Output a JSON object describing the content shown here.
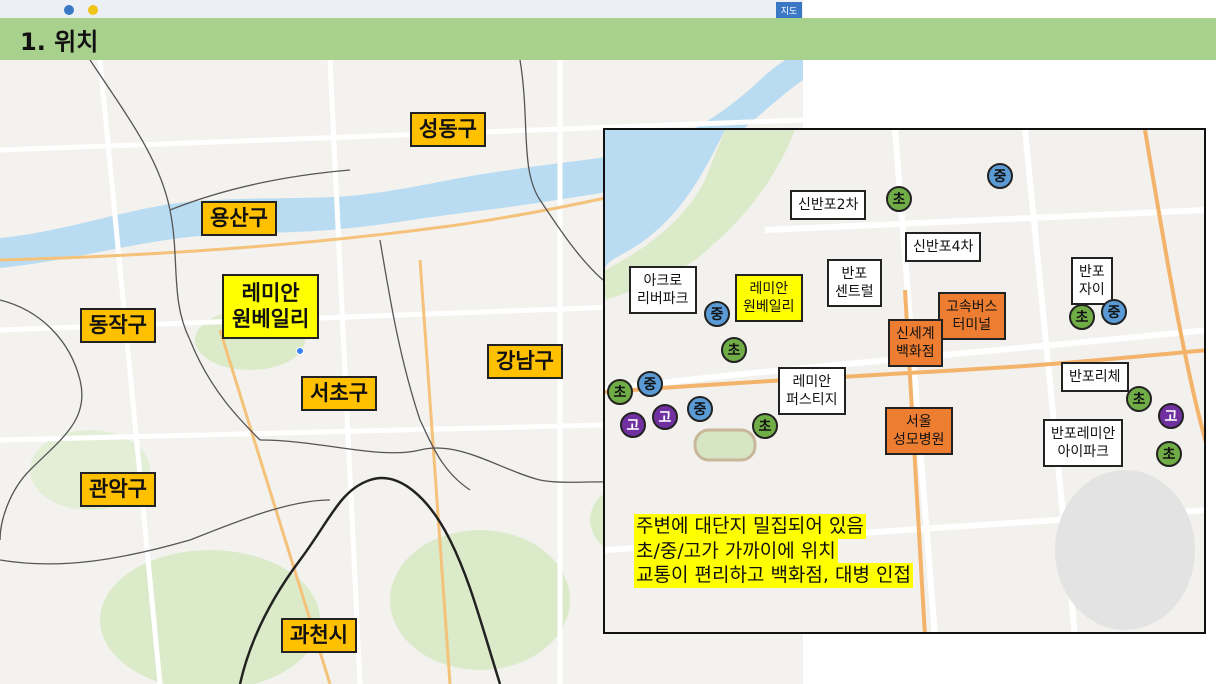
{
  "title": "1. 위치",
  "topbar": {
    "map_button": "지도"
  },
  "colors": {
    "district": "#ffc000",
    "target": "#ffff00",
    "title_bar": "#a9d18e",
    "landmark": "#ed7d31",
    "elementary": "#70ad47",
    "middle": "#5b9bd5",
    "high": "#7030a0"
  },
  "districts": {
    "seongdong": "성동구",
    "yongsan": "용산구",
    "dongjak": "동작구",
    "gangnam": "강남구",
    "seocho": "서초구",
    "gwanak": "관악구",
    "gwacheon": "과천시"
  },
  "target": {
    "line1": "레미안",
    "line2": "원베일리"
  },
  "inset": {
    "apartments": {
      "sinbanpo2": "신반포2차",
      "sinbanpo4": "신반포4차",
      "acro_line1": "아크로",
      "acro_line2": "리버파크",
      "banpo_central_line1": "반포",
      "banpo_central_line2": "센트럴",
      "banpo_xi_line1": "반포",
      "banpo_xi_line2": "자이",
      "raemian_prestige_line1": "레미안",
      "raemian_prestige_line2": "퍼스티지",
      "banpo_riche": "반포리체",
      "banpo_raemian_ipark_line1": "반포레미안",
      "banpo_raemian_ipark_line2": "아이파크"
    },
    "target": {
      "line1": "레미안",
      "line2": "원베일리"
    },
    "landmarks": {
      "express_bus_line1": "고속버스",
      "express_bus_line2": "터미널",
      "shinsegae_line1": "신세계",
      "shinsegae_line2": "백화점",
      "hospital_line1": "서울",
      "hospital_line2": "성모병원"
    },
    "schools": {
      "elementary": "초",
      "middle": "중",
      "high": "고"
    },
    "notes": [
      "주변에 대단지 밀집되어 있음",
      "초/중/고가 가까이에 위치",
      "교통이 편리하고 백화점, 대병 인접"
    ]
  }
}
